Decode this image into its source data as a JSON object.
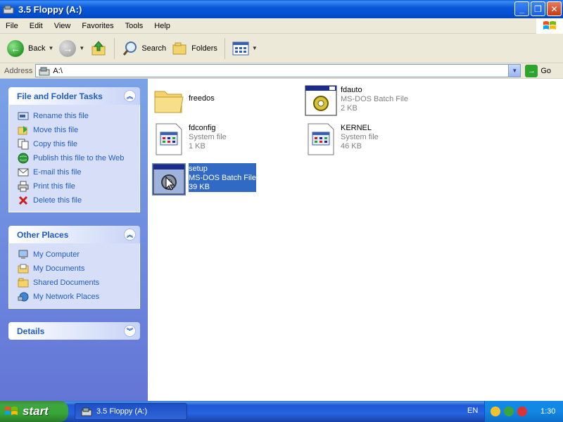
{
  "window": {
    "title": "3.5 Floppy (A:)"
  },
  "menu": [
    "File",
    "Edit",
    "View",
    "Favorites",
    "Tools",
    "Help"
  ],
  "toolbar": {
    "back": "Back",
    "search": "Search",
    "folders": "Folders"
  },
  "address": {
    "label": "Address",
    "value": "A:\\",
    "go": "Go"
  },
  "file_tasks": {
    "title": "File and Folder Tasks",
    "items": [
      {
        "label": "Rename this file",
        "icon": "rename-icon"
      },
      {
        "label": "Move this file",
        "icon": "move-icon"
      },
      {
        "label": "Copy this file",
        "icon": "copy-icon"
      },
      {
        "label": "Publish this file to the Web",
        "icon": "globe-icon"
      },
      {
        "label": "E-mail this file",
        "icon": "email-icon"
      },
      {
        "label": "Print this file",
        "icon": "printer-icon"
      },
      {
        "label": "Delete this file",
        "icon": "delete-icon"
      }
    ]
  },
  "other_places": {
    "title": "Other Places",
    "items": [
      {
        "label": "My Computer",
        "icon": "computer-icon"
      },
      {
        "label": "My Documents",
        "icon": "documents-folder-icon"
      },
      {
        "label": "Shared Documents",
        "icon": "shared-folder-icon"
      },
      {
        "label": "My Network Places",
        "icon": "network-icon"
      }
    ]
  },
  "details": {
    "title": "Details"
  },
  "files": [
    {
      "name": "freedos",
      "type": "",
      "size": "",
      "kind": "folder"
    },
    {
      "name": "fdauto",
      "type": "MS-DOS Batch File",
      "size": "2 KB",
      "kind": "batch"
    },
    {
      "name": "fdconfig",
      "type": "System file",
      "size": "1 KB",
      "kind": "system"
    },
    {
      "name": "KERNEL",
      "type": "System file",
      "size": "46 KB",
      "kind": "system"
    },
    {
      "name": "setup",
      "type": "MS-DOS Batch File",
      "size": "39 KB",
      "kind": "batch",
      "selected": true
    }
  ],
  "taskbar": {
    "start": "start",
    "task": "3.5 Floppy (A:)",
    "lang": "EN",
    "clock": "1:30"
  },
  "colors": {
    "title_bar": "#0054e3",
    "task_pane": "#6f8fe0",
    "link": "#215dc6",
    "selection": "#316ac5",
    "start_green": "#3ea63e"
  }
}
